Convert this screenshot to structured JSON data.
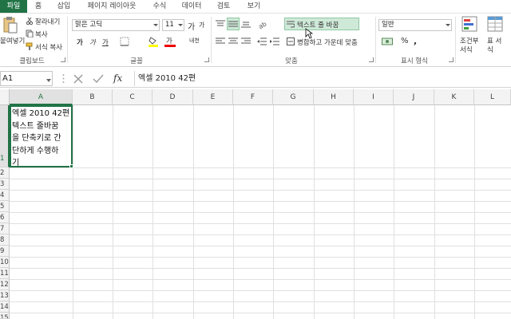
{
  "tabs": [
    "파일",
    "홈",
    "삽입",
    "페이지 레이아웃",
    "수식",
    "데이터",
    "검토",
    "보기"
  ],
  "clipboard": {
    "paste": "붙여넣기",
    "cut": "잘라내기",
    "copy": "복사",
    "format_painter": "서식 복사",
    "label": "클립보드"
  },
  "font": {
    "name": "맑은 고딕",
    "size": "11",
    "grow": "가",
    "shrink": "가",
    "bold": "가",
    "italic": "가",
    "underline": "가",
    "font_color": "가",
    "phonetic": "내천",
    "label": "글꼴"
  },
  "alignment": {
    "wrap_text": "텍스트 줄 바꿈",
    "merge_center": "병합하고 가운데 맞춤",
    "label": "맞춤"
  },
  "number": {
    "format": "일반",
    "percent": "%",
    "comma": ",",
    "label": "표시 형식"
  },
  "styles": {
    "conditional": "조건부 서식",
    "table_format": "표 서식"
  },
  "formula_bar": {
    "name_box": "A1",
    "fx": "fx",
    "content": "엑셀 2010 42편"
  },
  "columns": [
    "A",
    "B",
    "C",
    "D",
    "E",
    "F",
    "G",
    "H",
    "I",
    "J",
    "K",
    "L"
  ],
  "rows": [
    "1",
    "2",
    "3",
    "4",
    "5",
    "6",
    "7",
    "8",
    "9",
    "10",
    "11",
    "12",
    "13",
    "14",
    "15"
  ],
  "cell_a1": {
    "lines": [
      "엑셀 2010 42편",
      "텍스트 줄바꿈",
      "을 단축키로 간",
      "단하게 수행하",
      "기"
    ]
  },
  "colors": {
    "accent": "#217346",
    "highlight": "#cfe9d8"
  }
}
